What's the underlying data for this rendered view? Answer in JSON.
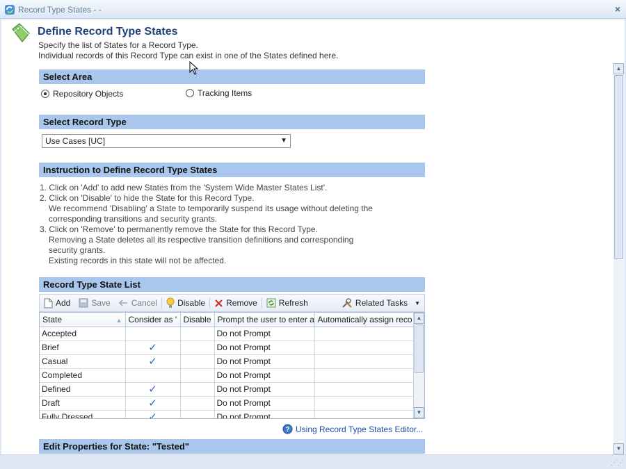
{
  "window": {
    "title": "Record Type States - -",
    "close_glyph": "×"
  },
  "header": {
    "title": "Define Record Type States",
    "subtitle_line1": "Specify the list of States for a Record Type.",
    "subtitle_line2": "Individual records of this Record Type can exist in one of the States defined here.",
    "icon": "tag-icon"
  },
  "select_area": {
    "heading": "Select Area",
    "options": [
      {
        "label": "Repository Objects",
        "selected": true
      },
      {
        "label": "Tracking Items",
        "selected": false
      }
    ]
  },
  "select_record_type": {
    "heading": "Select Record Type",
    "value": "Use Cases [UC]"
  },
  "instructions": {
    "heading": "Instruction to Define Record Type States",
    "lines": [
      "1. Click on 'Add' to add new States from the 'System Wide Master States List'.",
      "2. Click on 'Disable' to hide the State for this Record Type.",
      "We recommend 'Disabling' a State to temporarily suspend its usage without deleting the",
      "corresponding transitions and security grants.",
      "3. Click on 'Remove' to permanently remove the State for this Record Type.",
      "Removing a State deletes all its respective transition definitions and corresponding",
      "security grants.",
      "Existing records in this state will not be affected."
    ]
  },
  "state_list": {
    "heading": "Record Type State List",
    "toolbar": {
      "add": "Add",
      "save": "Save",
      "cancel": "Cancel",
      "disable": "Disable",
      "remove": "Remove",
      "refresh": "Refresh",
      "related_tasks": "Related Tasks"
    },
    "columns": [
      "State",
      "Consider as '",
      "Disable",
      "Prompt the user to enter a",
      "Automatically assign reco"
    ],
    "rows": [
      {
        "state": "Accepted",
        "consider": false,
        "prompt": "Do not Prompt"
      },
      {
        "state": "Brief",
        "consider": true,
        "prompt": "Do not Prompt"
      },
      {
        "state": "Casual",
        "consider": true,
        "prompt": "Do not Prompt"
      },
      {
        "state": "Completed",
        "consider": false,
        "prompt": "Do not Prompt"
      },
      {
        "state": "Defined",
        "consider": true,
        "prompt": "Do not Prompt"
      },
      {
        "state": "Draft",
        "consider": true,
        "prompt": "Do not Prompt"
      },
      {
        "state": "Fully Dressed",
        "consider": true,
        "prompt": "Do not Prompt"
      }
    ],
    "check_glyph": "✓"
  },
  "help_link": "Using Record Type States Editor...",
  "edit_properties": {
    "heading": "Edit Properties for State: \"Tested\""
  },
  "colors": {
    "section_bg": "#a9c7ec",
    "title": "#1f3f7a",
    "link": "#1f4ea0",
    "check": "#2f66c2"
  }
}
